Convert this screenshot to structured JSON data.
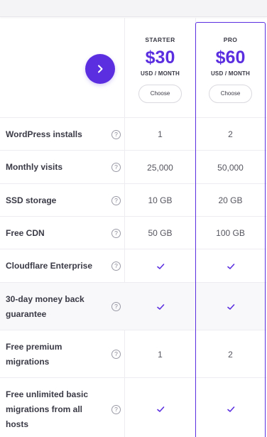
{
  "plans": [
    {
      "name": "STARTER",
      "price": "$30",
      "unit": "USD / MONTH",
      "choose_label": "Choose"
    },
    {
      "name": "PRO",
      "price": "$60",
      "unit": "USD / MONTH",
      "choose_label": "Choose"
    }
  ],
  "info_glyph": "?",
  "accent_color": "#5b2fe0",
  "features": [
    {
      "label": "WordPress installs",
      "starter": "1",
      "pro": "2"
    },
    {
      "label": "Monthly visits",
      "starter": "25,000",
      "pro": "50,000"
    },
    {
      "label": "SSD storage",
      "starter": "10 GB",
      "pro": "20 GB"
    },
    {
      "label": "Free CDN",
      "starter": "50 GB",
      "pro": "100 GB"
    },
    {
      "label": "Cloudflare Enterprise",
      "starter": "check",
      "pro": "check"
    },
    {
      "label": "30-day money back guarantee",
      "starter": "check",
      "pro": "check"
    },
    {
      "label": "Free premium migrations",
      "starter": "1",
      "pro": "2"
    },
    {
      "label": "Free unlimited basic migrations from all hosts",
      "starter": "check",
      "pro": "check"
    }
  ],
  "icons": {
    "next": "chevron-right-icon",
    "info": "question-circle-icon",
    "included": "checkmark-icon"
  }
}
